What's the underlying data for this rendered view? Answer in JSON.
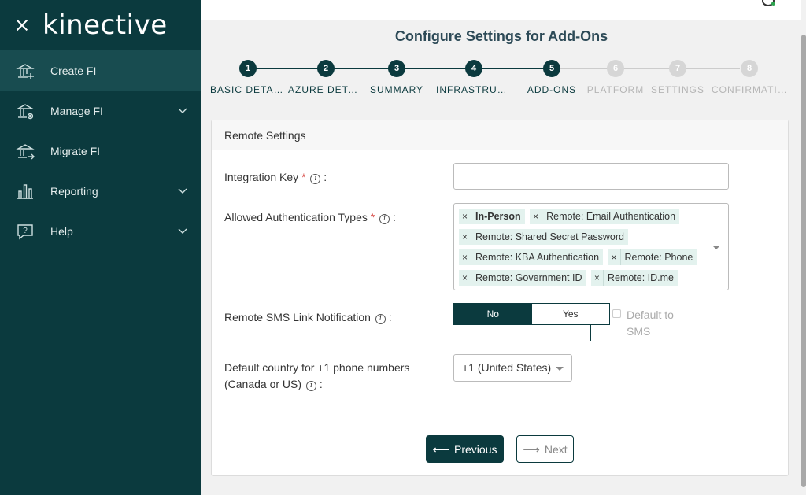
{
  "brand": {
    "logo_text": "kinective"
  },
  "sidebar": {
    "items": [
      {
        "label": "Create FI",
        "icon": "bank-add-icon",
        "active": true,
        "expandable": false
      },
      {
        "label": "Manage FI",
        "icon": "bank-gear-icon",
        "active": false,
        "expandable": true
      },
      {
        "label": "Migrate FI",
        "icon": "bank-arrow-icon",
        "active": false,
        "expandable": false
      },
      {
        "label": "Reporting",
        "icon": "bar-chart-icon",
        "active": false,
        "expandable": true
      },
      {
        "label": "Help",
        "icon": "help-chat-icon",
        "active": false,
        "expandable": true
      }
    ]
  },
  "page": {
    "title": "Configure Settings for Add-Ons"
  },
  "stepper": {
    "current": 5,
    "steps": [
      {
        "number": "1",
        "label": "BASIC DETAILS"
      },
      {
        "number": "2",
        "label": "AZURE DETAILS"
      },
      {
        "number": "3",
        "label": "SUMMARY"
      },
      {
        "number": "4",
        "label": "INFRASTRUCTURE"
      },
      {
        "number": "5",
        "label": "ADD-ONS"
      },
      {
        "number": "6",
        "label": "PLATFORM"
      },
      {
        "number": "7",
        "label": "SETTINGS"
      },
      {
        "number": "8",
        "label": "CONFIRMATION"
      }
    ]
  },
  "card": {
    "header": "Remote Settings",
    "integration_key": {
      "label": "Integration Key",
      "required_mark": "*",
      "colon": ":",
      "value": ""
    },
    "auth_types": {
      "label": "Allowed Authentication Types",
      "required_mark": "*",
      "colon": ":",
      "tags": [
        {
          "text": "In-Person",
          "bold": true
        },
        {
          "text": "Remote: Email Authentication",
          "bold": false
        },
        {
          "text": "Remote: Shared Secret Password",
          "bold": false
        },
        {
          "text": "Remote: KBA Authentication",
          "bold": false
        },
        {
          "text": "Remote: Phone",
          "bold": false
        },
        {
          "text": "Remote: Government ID",
          "bold": false
        },
        {
          "text": "Remote: ID.me",
          "bold": false
        }
      ],
      "remove_glyph": "×"
    },
    "sms": {
      "label": "Remote SMS Link Notification",
      "colon": ":",
      "options": [
        "No",
        "Yes"
      ],
      "selected": "No",
      "default_label": "Default to SMS",
      "default_checked": false
    },
    "country": {
      "label_line1": "Default country for +1 phone numbers",
      "label_line2": "(Canada or US)",
      "colon": ":",
      "value": "+1 (United States)"
    },
    "buttons": {
      "previous": "Previous",
      "next": "Next"
    }
  },
  "colors": {
    "primary": "#0b3a3e",
    "tag_bg": "#e3f2ee",
    "required": "#d9534f"
  }
}
